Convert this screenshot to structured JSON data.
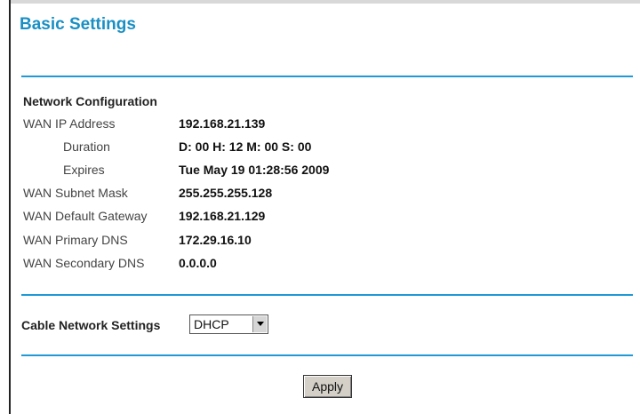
{
  "page": {
    "title": "Basic Settings"
  },
  "network_configuration": {
    "heading": "Network Configuration",
    "rows": [
      {
        "label": "WAN IP Address",
        "value": "192.168.21.139"
      },
      {
        "label": "Duration",
        "value": "D: 00 H: 12 M: 00 S: 00"
      },
      {
        "label": "Expires",
        "value": "Tue May 19 01:28:56 2009"
      },
      {
        "label": "WAN Subnet Mask",
        "value": "255.255.255.128"
      },
      {
        "label": "WAN Default Gateway",
        "value": "192.168.21.129"
      },
      {
        "label": "WAN Primary DNS",
        "value": "172.29.16.10"
      },
      {
        "label": "WAN Secondary DNS",
        "value": "0.0.0.0"
      }
    ]
  },
  "cable_network": {
    "label": "Cable Network Settings",
    "selected": "DHCP"
  },
  "actions": {
    "apply_label": "Apply"
  },
  "colors": {
    "title": "#1a8fc4",
    "divider": "#1f9ad6"
  }
}
